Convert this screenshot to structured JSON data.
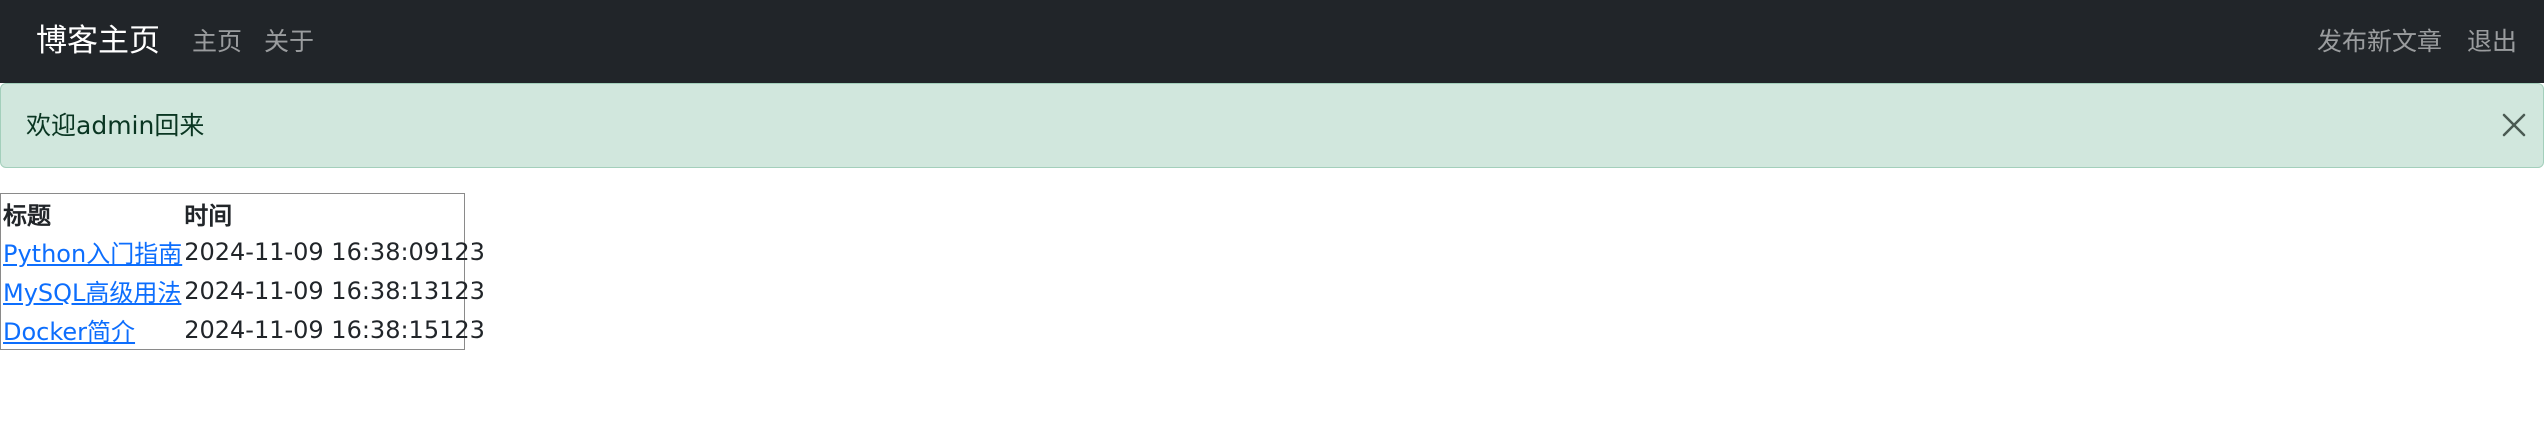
{
  "navbar": {
    "brand": "博客主页",
    "links": [
      "主页",
      "关于"
    ],
    "right_links": [
      "发布新文章",
      "退出"
    ],
    "background": "#212529"
  },
  "alert": {
    "message": "欢迎admin回来",
    "close_icon": "close-icon",
    "background": "#d1e7dd"
  },
  "posts": {
    "headers": [
      "标题",
      "时间"
    ],
    "rows": [
      {
        "title": "Python入门指南",
        "time": "2024-11-09 16:38:09123"
      },
      {
        "title": "MySQL高级用法",
        "time": "2024-11-09 16:38:13123"
      },
      {
        "title": "Docker简介",
        "time": "2024-11-09 16:38:15123"
      }
    ],
    "link_color": "#0d6efd"
  }
}
